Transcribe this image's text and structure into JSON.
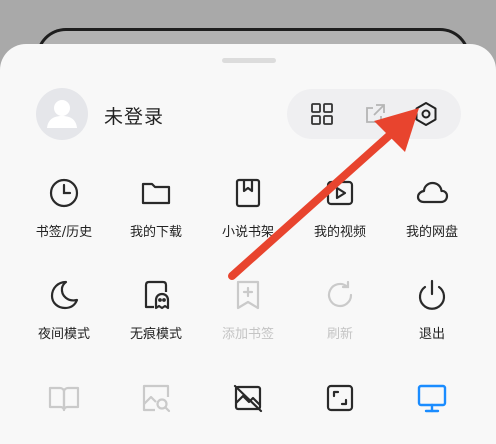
{
  "account": {
    "name": "未登录",
    "avatar_icon": "user-avatar-icon"
  },
  "quick_actions": [
    {
      "icon": "qr-scan-icon"
    },
    {
      "icon": "share-icon"
    },
    {
      "icon": "settings-icon"
    }
  ],
  "menu": {
    "row1": [
      {
        "label": "书签/历史",
        "icon": "clock-icon"
      },
      {
        "label": "我的下载",
        "icon": "folder-icon"
      },
      {
        "label": "小说书架",
        "icon": "bookmark-book-icon"
      },
      {
        "label": "我的视频",
        "icon": "video-play-icon"
      },
      {
        "label": "我的网盘",
        "icon": "cloud-icon"
      }
    ],
    "row2": [
      {
        "label": "夜间模式",
        "icon": "moon-icon"
      },
      {
        "label": "无痕模式",
        "icon": "ghost-icon"
      },
      {
        "label": "添加书签",
        "icon": "add-bookmark-icon",
        "disabled": true
      },
      {
        "label": "刷新",
        "icon": "refresh-icon",
        "disabled": true
      },
      {
        "label": "退出",
        "icon": "power-icon"
      }
    ],
    "row3": [
      {
        "icon": "book-open-icon",
        "disabled": true
      },
      {
        "icon": "image-search-icon",
        "disabled": true
      },
      {
        "icon": "no-image-icon"
      },
      {
        "icon": "fullscreen-icon"
      },
      {
        "icon": "pc-mode-icon",
        "active_color": "#1a8cff"
      }
    ]
  },
  "colors": {
    "annotation_arrow": "#e8442e",
    "icon_default": "#2a2a2a",
    "icon_disabled": "#c8c8c8",
    "accent": "#1a8cff"
  }
}
